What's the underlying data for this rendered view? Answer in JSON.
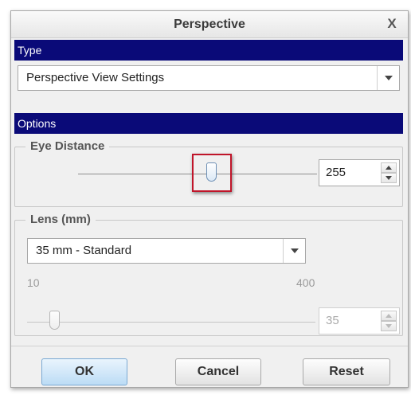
{
  "dialog": {
    "title": "Perspective",
    "close_glyph": "X"
  },
  "type_section": {
    "header": "Type",
    "dropdown_value": "Perspective View Settings"
  },
  "options_section": {
    "header": "Options",
    "eye_distance": {
      "legend": "Eye Distance",
      "value": "255",
      "slider_level": 0.5
    },
    "lens": {
      "legend": "Lens (mm)",
      "dropdown_value": "35 mm - Standard",
      "range_min": "10",
      "range_max": "400",
      "value": "35",
      "slider_level": 0.0,
      "disabled": true
    }
  },
  "buttons": {
    "ok": "OK",
    "cancel": "Cancel",
    "reset": "Reset"
  },
  "colors": {
    "section_header_bg": "#0a0a78",
    "highlight_border": "#c0152a",
    "primary_button": "#bcdcf5"
  }
}
